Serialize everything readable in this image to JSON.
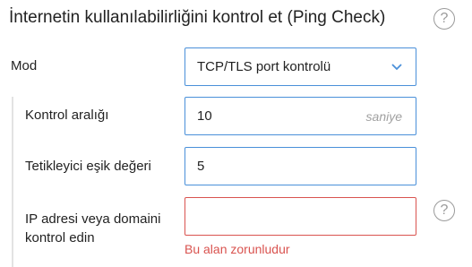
{
  "header": {
    "title": "İnternetin kullanılabilirliğini kontrol et (Ping Check)",
    "help_icon": "question-mark-circle-icon"
  },
  "form": {
    "mode": {
      "label": "Mod",
      "selected": "TCP/TLS port kontrolü",
      "icon": "chevron-down-icon"
    },
    "interval": {
      "label": "Kontrol aralığı",
      "value": "10",
      "unit": "saniye"
    },
    "threshold": {
      "label": "Tetikleyici eşik değeri",
      "value": "5"
    },
    "target": {
      "label": "IP adresi veya domaini kontrol edin",
      "value": "",
      "error": "Bu alan zorunludur",
      "help_icon": "question-mark-circle-icon"
    }
  },
  "colors": {
    "accent_border": "#4a90d9",
    "error": "#d9534f",
    "muted": "#9a9a9a"
  }
}
